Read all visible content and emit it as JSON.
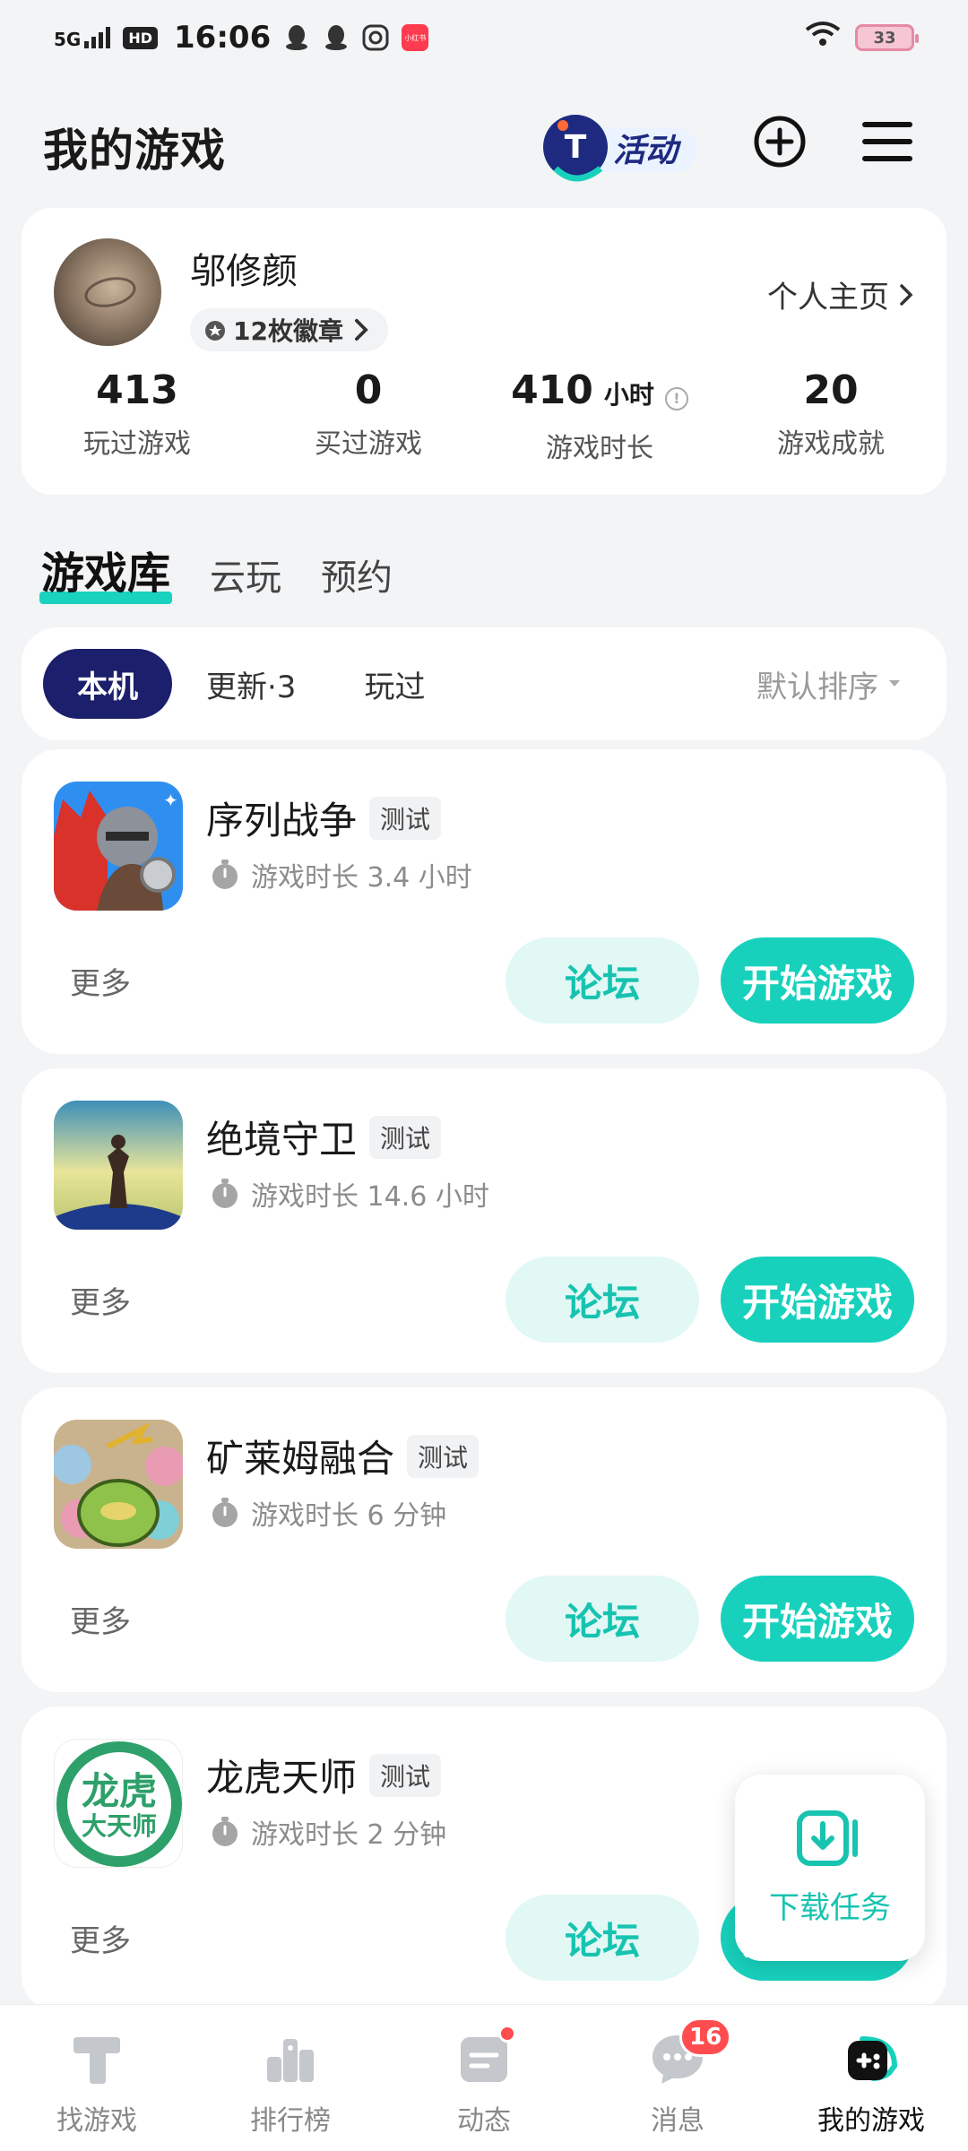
{
  "status_bar": {
    "network": "5G",
    "hd": "HD",
    "time": "16:06",
    "battery": "33"
  },
  "header": {
    "title": "我的游戏",
    "activity_label": "活动"
  },
  "profile": {
    "name": "邬修颜",
    "badges": "12枚徽章",
    "homepage_link": "个人主页",
    "stats": [
      {
        "value": "413",
        "unit": "",
        "label": "玩过游戏"
      },
      {
        "value": "0",
        "unit": "",
        "label": "买过游戏"
      },
      {
        "value": "410",
        "unit": "小时",
        "label": "游戏时长"
      },
      {
        "value": "20",
        "unit": "",
        "label": "游戏成就"
      }
    ]
  },
  "section_tabs": [
    "游戏库",
    "云玩",
    "预约"
  ],
  "filters": {
    "chips": [
      "本机",
      "更新·3",
      "玩过"
    ],
    "sort_label": "默认排序"
  },
  "games": [
    {
      "name": "序列战争",
      "tag": "测试",
      "playtime": "游戏时长 3.4 小时",
      "more": "更多",
      "forum": "论坛",
      "play": "开始游戏"
    },
    {
      "name": "绝境守卫",
      "tag": "测试",
      "playtime": "游戏时长 14.6 小时",
      "more": "更多",
      "forum": "论坛",
      "play": "开始游戏"
    },
    {
      "name": "矿莱姆融合",
      "tag": "测试",
      "playtime": "游戏时长 6 分钟",
      "more": "更多",
      "forum": "论坛",
      "play": "开始游戏"
    },
    {
      "name": "龙虎天师",
      "tag": "测试",
      "playtime": "游戏时长 2 分钟",
      "more": "更多",
      "forum": "论坛",
      "play": "开始游戏",
      "icon_text_1": "龙虎",
      "icon_text_2": "大天师"
    }
  ],
  "download_float": {
    "label": "下载任务"
  },
  "bottom_nav": [
    {
      "label": "找游戏",
      "icon": "find-game-icon"
    },
    {
      "label": "排行榜",
      "icon": "ranking-icon"
    },
    {
      "label": "动态",
      "icon": "feed-icon"
    },
    {
      "label": "消息",
      "icon": "message-icon",
      "badge": "16"
    },
    {
      "label": "我的游戏",
      "icon": "my-games-icon"
    }
  ],
  "colors": {
    "accent": "#18d1bd",
    "accent_light": "#e1f8f5",
    "nav_active_chip": "#1c1f6b",
    "badge_red": "#ff4d4f"
  }
}
